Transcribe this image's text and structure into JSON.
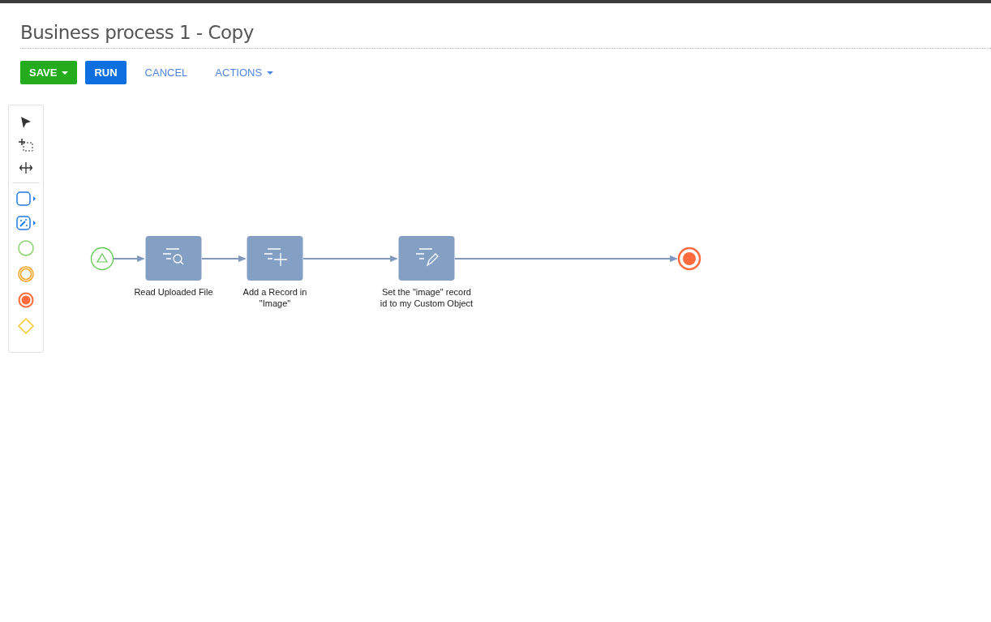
{
  "title": "Business process 1 - Copy",
  "buttons": [
    {
      "label": "SAVE",
      "kind": "success",
      "dropdown": true
    },
    {
      "label": "RUN",
      "kind": "primary",
      "dropdown": false
    },
    {
      "label": "CANCEL",
      "kind": "link",
      "dropdown": false
    },
    {
      "label": "ACTIONS",
      "kind": "link",
      "dropdown": true
    }
  ],
  "diagram": {
    "nodes": [
      {
        "kind": "start"
      },
      {
        "kind": "read",
        "label": "Read Uploaded File"
      },
      {
        "kind": "add",
        "label": "Add a Record in \"Image\""
      },
      {
        "kind": "modify",
        "label": "Set the \"image\" record id to my Custom Object"
      },
      {
        "kind": "end"
      }
    ]
  }
}
